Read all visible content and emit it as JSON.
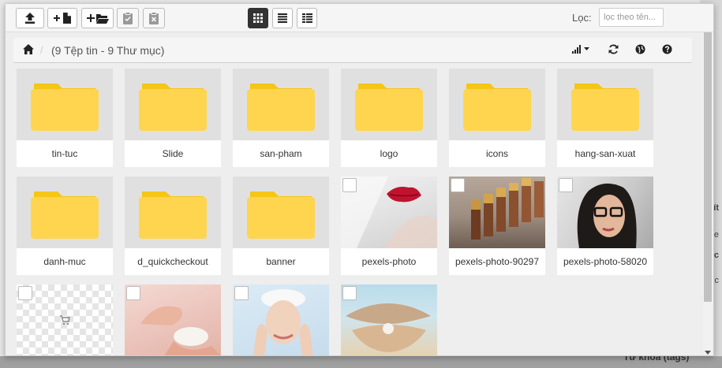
{
  "toolbar": {
    "buttons": [
      {
        "name": "upload-button",
        "icon": "upload-icon"
      },
      {
        "name": "new-file-button",
        "icon": "new-file-icon"
      },
      {
        "name": "new-folder-button",
        "icon": "new-folder-icon"
      },
      {
        "name": "paste-button",
        "icon": "clipboard-check-icon"
      },
      {
        "name": "clear-clipboard-button",
        "icon": "clipboard-x-icon"
      }
    ],
    "views": [
      {
        "name": "view-grid-button",
        "icon": "grid-icon",
        "active": true
      },
      {
        "name": "view-list-button",
        "icon": "list-icon",
        "active": false
      },
      {
        "name": "view-columns-button",
        "icon": "columns-icon",
        "active": false
      }
    ],
    "filter_label": "Lọc:",
    "filter_placeholder": "lọc theo tên..."
  },
  "breadcrumb": {
    "separator": "/",
    "summary": "(9 Tệp tin - 9 Thư mục)",
    "actions": [
      "sort-icon",
      "refresh-icon",
      "language-icon",
      "help-icon"
    ]
  },
  "background": {
    "right_fragments": [
      "ít",
      "tle",
      "esc",
      "esc"
    ],
    "bottom_fragment": "Từ khóa (tags)"
  },
  "items": [
    {
      "type": "folder",
      "name": "tin-tuc"
    },
    {
      "type": "folder",
      "name": "Slide"
    },
    {
      "type": "folder",
      "name": "san-pham"
    },
    {
      "type": "folder",
      "name": "logo"
    },
    {
      "type": "folder",
      "name": "icons"
    },
    {
      "type": "folder",
      "name": "hang-san-xuat"
    },
    {
      "type": "folder",
      "name": "danh-muc"
    },
    {
      "type": "folder",
      "name": "d_quickcheckout"
    },
    {
      "type": "folder",
      "name": "banner"
    },
    {
      "type": "image",
      "name": "pexels-photo",
      "thumb": "lips"
    },
    {
      "type": "image",
      "name": "pexels-photo-90297",
      "thumb": "lipsticks"
    },
    {
      "type": "image",
      "name": "pexels-photo-58020",
      "thumb": "woman-glasses"
    },
    {
      "type": "image",
      "name": "",
      "thumb": "transparent"
    },
    {
      "type": "image",
      "name": "",
      "thumb": "cream-hands"
    },
    {
      "type": "image",
      "name": "",
      "thumb": "face-wash"
    },
    {
      "type": "image",
      "name": "",
      "thumb": "pearl-shell"
    }
  ],
  "colors": {
    "folder": "#ffd54f",
    "folder_tab": "#f5c518",
    "active_view": "#333333"
  }
}
